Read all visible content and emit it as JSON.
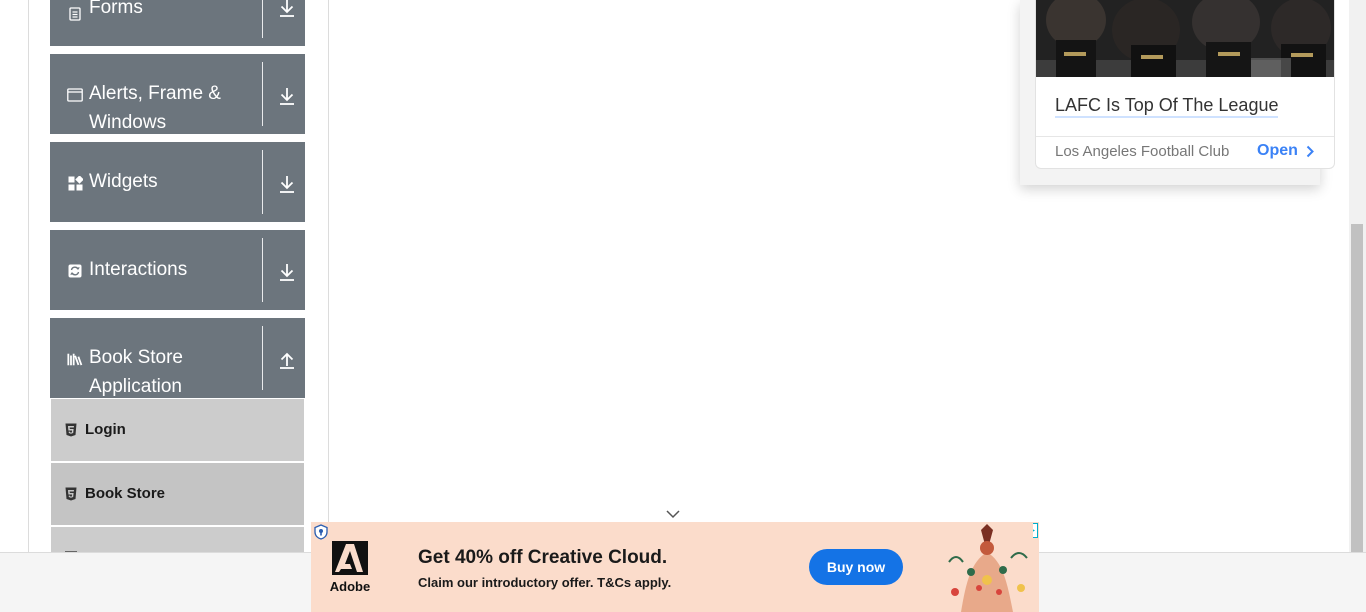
{
  "sidebar": {
    "groups": [
      {
        "label": "Forms",
        "icon": "form-icon",
        "expanded": false
      },
      {
        "label": "Alerts, Frame & Windows",
        "label_line1": "Alerts, Frame &",
        "label_line2": "Windows",
        "icon": "window-icon",
        "expanded": false
      },
      {
        "label": "Widgets",
        "icon": "widgets-icon",
        "expanded": false
      },
      {
        "label": "Interactions",
        "icon": "interactions-icon",
        "expanded": false
      },
      {
        "label": "Book Store Application",
        "label_line1": "Book Store",
        "label_line2": "Application",
        "icon": "books-icon",
        "expanded": true
      }
    ],
    "book_store_items": [
      {
        "label": "Login",
        "icon": "html5-icon"
      },
      {
        "label": "Book Store",
        "icon": "html5-icon"
      }
    ]
  },
  "right_ad": {
    "title": "LAFC Is Top Of The League",
    "source": "Los Angeles Football Club",
    "cta": "Open"
  },
  "banner_ad": {
    "brand": "Adobe",
    "headline": "Get 40% off Creative Cloud.",
    "subline": "Claim our introductory offer. T&Cs apply.",
    "cta": "Buy now"
  },
  "colors": {
    "group_header": "#6c757d",
    "login_item": "#cccccc",
    "bookstore_item": "#c4c4c4",
    "banner_bg": "#fbdccb",
    "buy_button": "#1473e6",
    "open_link": "#3b82f6"
  }
}
